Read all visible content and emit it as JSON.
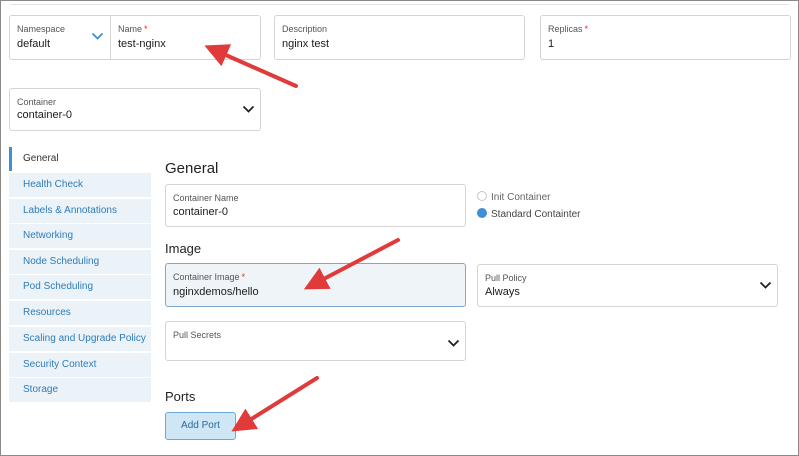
{
  "top": {
    "namespace": {
      "label": "Namespace",
      "value": "default"
    },
    "name": {
      "label": "Name",
      "required_mark": "*",
      "value": "test-nginx"
    },
    "description": {
      "label": "Description",
      "value": "nginx test"
    },
    "replicas": {
      "label": "Replicas",
      "required_mark": "*",
      "value": "1"
    }
  },
  "container_select": {
    "label": "Container",
    "value": "container-0"
  },
  "nav": {
    "items": [
      {
        "label": "General"
      },
      {
        "label": "Health Check"
      },
      {
        "label": "Labels & Annotations"
      },
      {
        "label": "Networking"
      },
      {
        "label": "Node Scheduling"
      },
      {
        "label": "Pod Scheduling"
      },
      {
        "label": "Resources"
      },
      {
        "label": "Scaling and Upgrade Policy"
      },
      {
        "label": "Security Context"
      },
      {
        "label": "Storage"
      }
    ],
    "active_index": 0
  },
  "general": {
    "heading": "General",
    "container_name": {
      "label": "Container Name",
      "value": "container-0"
    },
    "container_type": {
      "options": [
        "Init Container",
        "Standard Containter"
      ],
      "selected": "Standard Containter"
    }
  },
  "image": {
    "heading": "Image",
    "container_image": {
      "label": "Container Image",
      "required_mark": "*",
      "value": "nginxdemos/hello"
    },
    "pull_policy": {
      "label": "Pull Policy",
      "value": "Always"
    },
    "pull_secrets": {
      "label": "Pull Secrets"
    }
  },
  "ports": {
    "heading": "Ports",
    "add_button": "Add Port"
  },
  "colors": {
    "accent": "#3d8fd6",
    "nav_bg": "#ebf3f9",
    "nav_text": "#2f7bb8",
    "arrow": "#e03a3a",
    "required": "#d9302c"
  },
  "icons": {
    "dropdown": "chevron-down-icon",
    "annotation": "red-arrow-annotation"
  }
}
